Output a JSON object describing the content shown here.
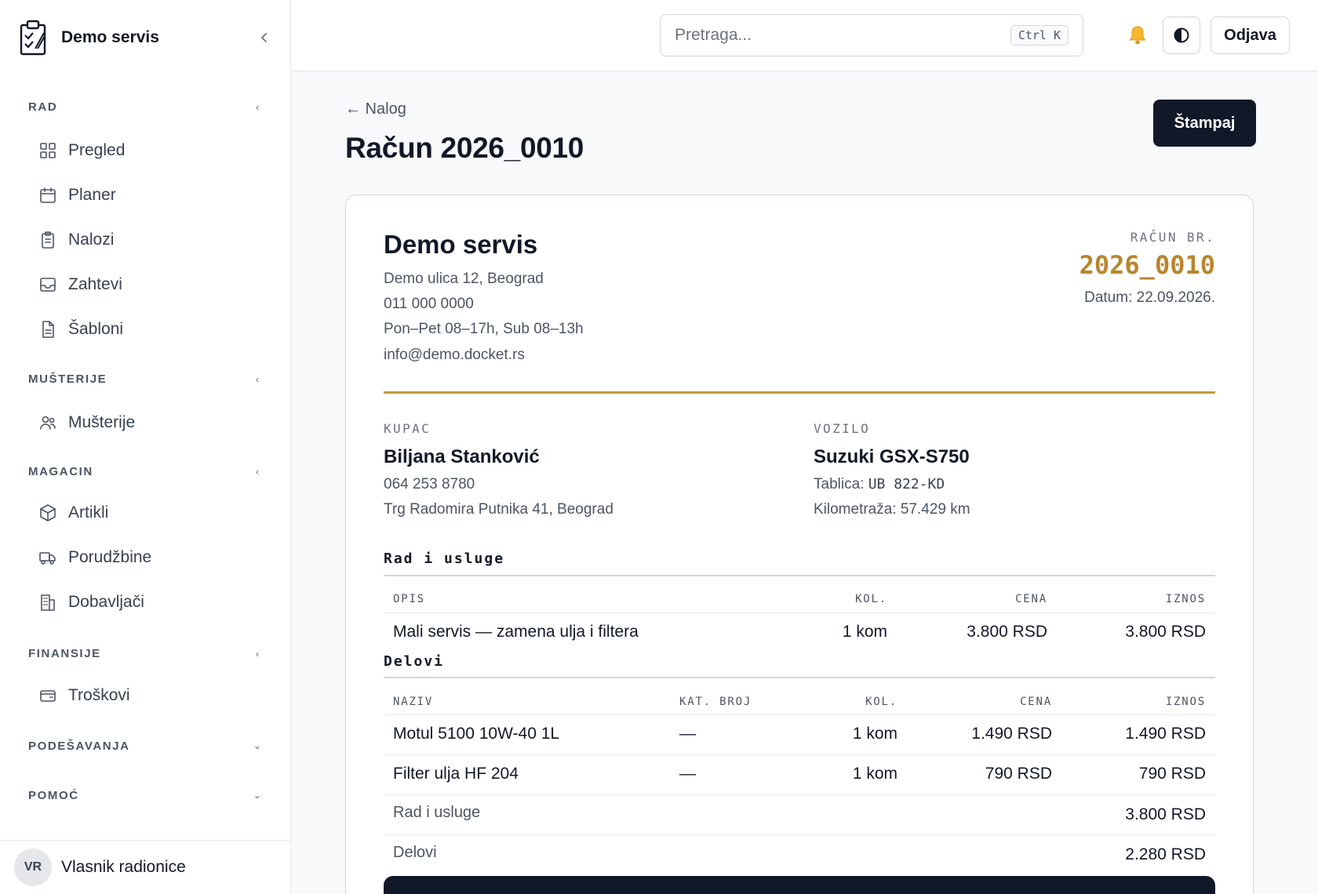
{
  "brand": {
    "name": "Demo servis",
    "collapse_icon": "chevron-left-icon"
  },
  "nav": {
    "sections": [
      {
        "title": "RAD",
        "chevron": "‹",
        "items": [
          {
            "label": "Pregled",
            "icon": "grid-icon"
          },
          {
            "label": "Planer",
            "icon": "calendar-icon"
          },
          {
            "label": "Nalozi",
            "icon": "clipboard-icon"
          },
          {
            "label": "Zahtevi",
            "icon": "inbox-icon"
          },
          {
            "label": "Šabloni",
            "icon": "file-text-icon"
          }
        ]
      },
      {
        "title": "MUŠTERIJE",
        "chevron": "‹",
        "items": [
          {
            "label": "Mušterije",
            "icon": "users-icon"
          }
        ]
      },
      {
        "title": "MAGACIN",
        "chevron": "‹",
        "items": [
          {
            "label": "Artikli",
            "icon": "package-icon"
          },
          {
            "label": "Porudžbine",
            "icon": "truck-icon"
          },
          {
            "label": "Dobavljači",
            "icon": "building-icon"
          }
        ]
      },
      {
        "title": "FINANSIJE",
        "chevron": "‹",
        "items": [
          {
            "label": "Troškovi",
            "icon": "wallet-icon"
          }
        ]
      },
      {
        "title": "PODEŠAVANJA",
        "chevron": "⌄",
        "items": []
      },
      {
        "title": "POMOĆ",
        "chevron": "⌄",
        "items": []
      }
    ]
  },
  "user": {
    "initials": "VR",
    "name": "Vlasnik radionice"
  },
  "topbar": {
    "search_placeholder": "Pretraga...",
    "search_shortcut": "Ctrl K",
    "logout_label": "Odjava"
  },
  "page": {
    "back_label": "← Nalog",
    "title": "Račun 2026_0010",
    "print_label": "Štampaj"
  },
  "invoice": {
    "company": {
      "name": "Demo servis",
      "address": "Demo ulica 12, Beograd",
      "phone": "011 000 0000",
      "hours": "Pon–Pet 08–17h, Sub 08–13h",
      "email": "info@demo.docket.rs"
    },
    "number_label": "RAČUN BR.",
    "number": "2026_0010",
    "date": "Datum: 22.09.2026.",
    "customer": {
      "label": "KUPAC",
      "name": "Biljana Stanković",
      "phone": "064 253 8780",
      "address": "Trg Radomira Putnika 41, Beograd"
    },
    "vehicle": {
      "label": "VOZILO",
      "name": "Suzuki GSX-S750",
      "plate_label": "Tablica: ",
      "plate": "UB 822-KD",
      "mileage": "Kilometraža: 57.429 km"
    },
    "services": {
      "title": "Rad i usluge",
      "headers": [
        "OPIS",
        "KOL.",
        "CENA",
        "IZNOS"
      ],
      "rows": [
        {
          "desc": "Mali servis — zamena ulja i filtera",
          "qty": "1 kom",
          "price": "3.800 RSD",
          "amount": "3.800 RSD"
        }
      ]
    },
    "parts": {
      "title": "Delovi",
      "headers": [
        "NAZIV",
        "KAT. BROJ",
        "KOL.",
        "CENA",
        "IZNOS"
      ],
      "rows": [
        {
          "name": "Motul 5100 10W-40 1L",
          "cat": "—",
          "qty": "1 kom",
          "price": "1.490 RSD",
          "amount": "1.490 RSD"
        },
        {
          "name": "Filter ulja HF 204",
          "cat": "—",
          "qty": "1 kom",
          "price": "790 RSD",
          "amount": "790 RSD"
        }
      ]
    },
    "subtotals": [
      {
        "label": "Rad i usluge",
        "value": "3.800 RSD"
      },
      {
        "label": "Delovi",
        "value": "2.280 RSD"
      }
    ]
  },
  "colors": {
    "accent_gold": "#c49a3f",
    "dark": "#111827"
  }
}
